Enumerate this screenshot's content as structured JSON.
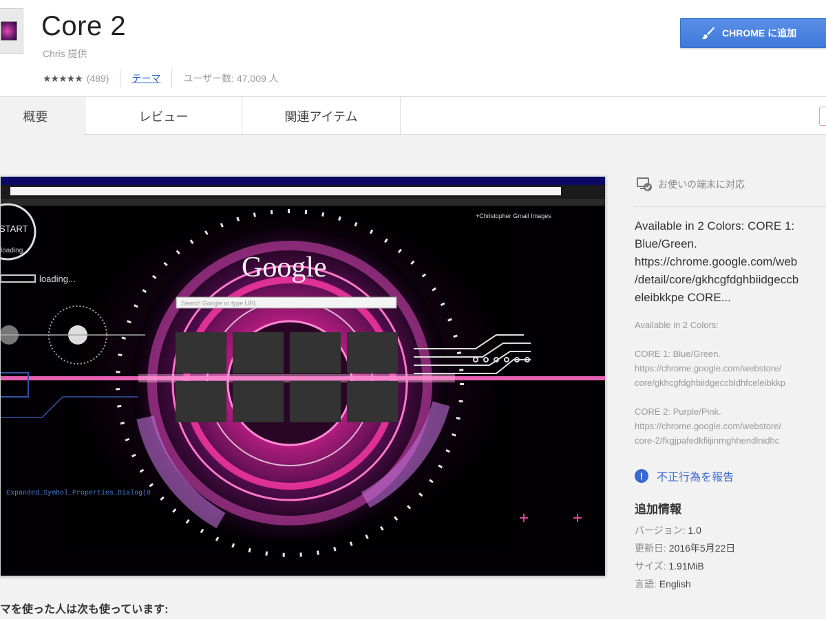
{
  "app": {
    "title": "Core 2",
    "provider": "Chris 提供",
    "stars": "★★★★★",
    "rating_count": "(489)",
    "category": "テーマ",
    "users": "ユーザー数: 47,009 人",
    "add_button_label": "CHROME に追加"
  },
  "tabs": [
    {
      "label": "概要",
      "active": true
    },
    {
      "label": "レビュー",
      "active": false
    },
    {
      "label": "関連アイテム",
      "active": false
    }
  ],
  "screenshot": {
    "start_label": "START",
    "loading_small": "loading...",
    "loading_label": "loading...",
    "google_logo": "Google",
    "search_placeholder": "Search Google or type URL",
    "user_links": "+Christopher  Gmail  Images",
    "code_line": "Expanded_Symbol_Properties_Dialog(0",
    "tile_color": "#333333",
    "accent": "#e0409a"
  },
  "sidebar": {
    "compat_label": "お使いの端末に対応",
    "description_main": "Available in 2 Colors: CORE 1:\nBlue/Green.\nhttps://chrome.google.com/web\n/detail/core/gkhcgfdghbiidgeccb\neleibkkpe CORE...",
    "description_small": "Available in 2 Colors:\n\nCORE 1: Blue/Green.\nhttps://chrome.google.com/webstore/\ncore/gkhcgfdghbiidgeccbldhfceleibkkp\n\nCORE 2: Purple/Pink.\nhttps://chrome.google.com/webstore/\ncore-2/fkgjpafedkfiijinmghhendlnidhc",
    "report_label": "不正行為を報告",
    "additional_title": "追加情報",
    "info": {
      "version_label": "バージョン:",
      "version": "1.0",
      "updated_label": "更新日:",
      "updated": "2016年5月22日",
      "size_label": "サイズ:",
      "size": "1.91MiB",
      "language_label": "言語:",
      "language": "English"
    }
  },
  "also_used": "マを使った人は次も使っています:"
}
